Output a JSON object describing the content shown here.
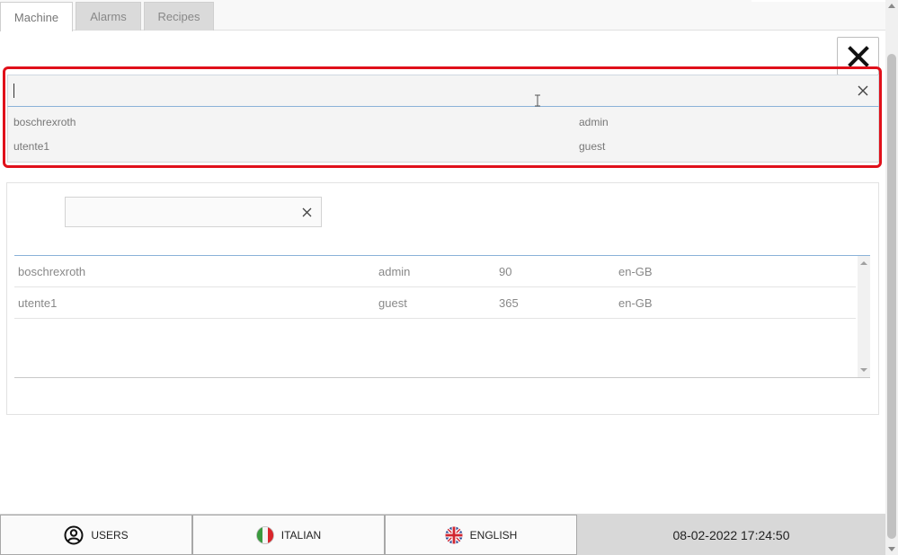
{
  "tabs": [
    {
      "label": "Machine",
      "active": true
    },
    {
      "label": "Alarms",
      "active": false
    },
    {
      "label": "Recipes",
      "active": false
    }
  ],
  "search": {
    "value": "",
    "suggestions": [
      {
        "user": "boschrexroth",
        "role": "admin"
      },
      {
        "user": "utente1",
        "role": "guest"
      }
    ]
  },
  "filter": {
    "value": ""
  },
  "users_table": {
    "rows": [
      {
        "user": "boschrexroth",
        "role": "admin",
        "days": "90",
        "language": "en-GB"
      },
      {
        "user": "utente1",
        "role": "guest",
        "days": "365",
        "language": "en-GB"
      }
    ]
  },
  "footer": {
    "users_label": "USERS",
    "italian_label": "ITALIAN",
    "english_label": "ENGLISH",
    "datetime": "08-02-2022 17:24:50"
  },
  "colors": {
    "highlight": "#e0101a",
    "accent_line": "#8ab2d8"
  }
}
